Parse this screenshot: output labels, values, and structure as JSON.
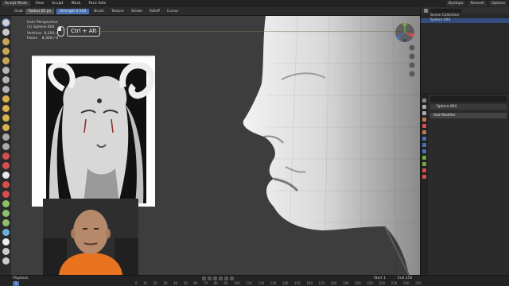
{
  "topbar": {
    "mode": "Sculpt Mode",
    "menu": [
      "View",
      "Sculpt",
      "Mask",
      "Face Sets"
    ],
    "right_tools": [
      "Dyntopo",
      "Remesh",
      "Options"
    ]
  },
  "toolheader": {
    "tool": "Grab",
    "radius_label": "Radius",
    "radius_value": "81 px",
    "strength_label": "Strength",
    "strength_value": "0.500",
    "dropdowns": [
      "Brush",
      "Texture",
      "Stroke",
      "Falloff",
      "Cursor"
    ]
  },
  "viewport": {
    "perspective": "User Perspective",
    "object": "(1) Sphere.004",
    "vertices_label": "Vertices",
    "vertices_value": "8,200 / 0",
    "faces_label": "Faces",
    "faces_value": "8,308 / 0",
    "shortcut": "Ctrl + Alt"
  },
  "outliner": {
    "rows": [
      "Scene Collection",
      "Sphere.004"
    ]
  },
  "properties": {
    "object_name": "Sphere.004",
    "add_modifier": "Add Modifier"
  },
  "timeline": {
    "playback": "Playback",
    "current_frame": "1",
    "start_label": "Start",
    "start_value": "1",
    "end_label": "End",
    "end_value": "250",
    "ruler": [
      "0",
      "10",
      "20",
      "30",
      "40",
      "50",
      "60",
      "70",
      "80",
      "90",
      "100",
      "110",
      "120",
      "130",
      "140",
      "150",
      "160",
      "170",
      "180",
      "190",
      "200",
      "210",
      "220",
      "230",
      "240",
      "250"
    ]
  },
  "colors": {
    "accent": "#4772b3",
    "viewport_bg": "#3d3d3d",
    "panel_bg": "#2b2b2b"
  }
}
